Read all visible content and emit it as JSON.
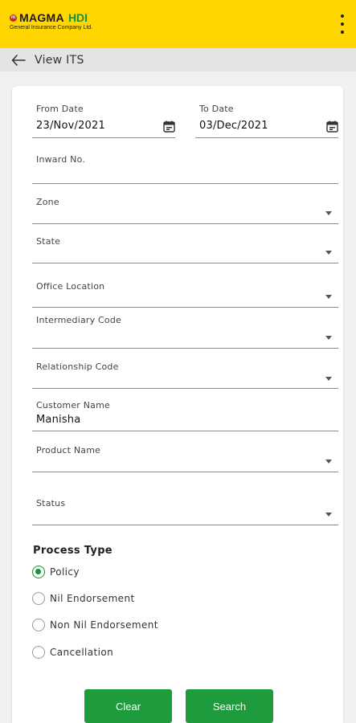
{
  "header": {
    "brand_name": "MAGMA",
    "brand_suffix": "HDI",
    "brand_tagline": "General Insurance Company Ltd.",
    "menu_icon": "more-vert-icon",
    "bg_color": "#ffd600"
  },
  "subheader": {
    "title": "View ITS",
    "back_icon": "arrow-left-icon"
  },
  "form": {
    "from_date": {
      "label": "From Date",
      "value": "23/Nov/2021",
      "icon": "calendar-icon"
    },
    "to_date": {
      "label": "To Date",
      "value": "03/Dec/2021",
      "icon": "calendar-icon"
    },
    "inward_no": {
      "label": "Inward No.",
      "value": ""
    },
    "zone": {
      "label": "Zone",
      "value": ""
    },
    "state": {
      "label": "State",
      "value": ""
    },
    "office_location": {
      "label": "Office Location",
      "value": ""
    },
    "intermediary_code": {
      "label": "Intermediary Code",
      "value": ""
    },
    "relationship_code": {
      "label": "Relationship Code",
      "value": ""
    },
    "customer_name": {
      "label": "Customer Name",
      "value": "Manisha"
    },
    "product_name": {
      "label": "Product Name",
      "value": ""
    },
    "status": {
      "label": "Status",
      "value": ""
    }
  },
  "process_type": {
    "title": "Process Type",
    "options": [
      {
        "label": "Policy",
        "checked": true
      },
      {
        "label": "Nil Endorsement",
        "checked": false
      },
      {
        "label": "Non Nil Endorsement",
        "checked": false
      },
      {
        "label": "Cancellation",
        "checked": false
      }
    ]
  },
  "buttons": {
    "clear_label": "Clear",
    "search_label": "Search",
    "color": "#1e9b3d"
  }
}
